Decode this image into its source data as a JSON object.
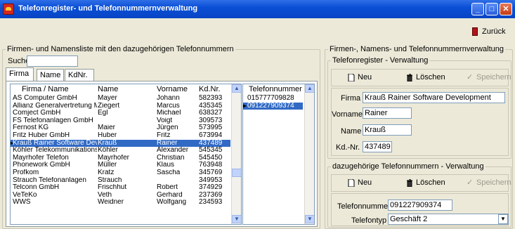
{
  "window": {
    "title": "Telefonregister- und Telefonnummernverwaltung"
  },
  "toolbar": {
    "back_label": "Zurück"
  },
  "left": {
    "legend": "Firmen- und Namensliste mit den dazugehörigen Telefonnummern",
    "search_label": "Suche",
    "search_value": "",
    "tabs": [
      "Firma",
      "Name",
      "KdNr."
    ],
    "columns": [
      "Firma / Name",
      "Name",
      "Vorname",
      "Kd.Nr."
    ],
    "rows": [
      [
        "AS Computer GmbH",
        "Mayer",
        "Johann",
        "582393"
      ],
      [
        "Allianz Generalvertretung Marcu",
        "Ziegert",
        "Marcus",
        "435345"
      ],
      [
        "Comject GmbH",
        "Egl",
        "Michael",
        "638327"
      ],
      [
        "FS Telefonanlagen GmbH",
        "",
        "Voigt",
        "309573"
      ],
      [
        "Fernost KG",
        "Maier",
        "Jürgen",
        "573995"
      ],
      [
        "Fritz Huber GmbH",
        "Huber",
        "Fritz",
        "673994"
      ],
      [
        "Krauß Rainer Software Develop",
        "Krauß",
        "Rainer",
        "437489"
      ],
      [
        "Köhler Telekommunikationsanl",
        "Köhler",
        "Alexander",
        "545345"
      ],
      [
        "Mayrhofer Telefon",
        "Mayrhofer",
        "Christian",
        "545450"
      ],
      [
        "Phonework GmbH",
        "Müller",
        "Klaus",
        "763948"
      ],
      [
        "Profkom",
        "Kratz",
        "Sascha",
        "345769"
      ],
      [
        "Strauch Telefonanlagen",
        "Strauch",
        "",
        "349953"
      ],
      [
        "Telconn GmbH",
        "Frischhut",
        "Robert",
        "374929"
      ],
      [
        "VeTeKo",
        "Veth",
        "Gerhard",
        "237369"
      ],
      [
        "WWS",
        "Weidner",
        "Wolfgang",
        "234593"
      ]
    ],
    "selected_row": 6,
    "phone_header": "Telefonnummer",
    "phones": [
      "015777709828",
      "091227909374"
    ],
    "selected_phone": 1
  },
  "right": {
    "legend": "Firmen-, Namens- und Telefonnummernverwaltung",
    "register": {
      "legend": "Telefonregister - Verwaltung",
      "new": "Neu",
      "delete": "Löschen",
      "save": "Speichern",
      "firma_label": "Firma",
      "firma": "Krauß Rainer Software Development",
      "vorname_label": "Vorname",
      "vorname": "Rainer",
      "name_label": "Name",
      "name": "Krauß",
      "kdnr_label": "Kd.-Nr.",
      "kdnr": "437489"
    },
    "numbers": {
      "legend": "dazugehörige Telefonnummern - Verwaltung",
      "new": "Neu",
      "delete": "Löschen",
      "save": "Speichern",
      "phone_label": "Telefonnummer",
      "phone": "091227909374",
      "type_label": "Telefontyp",
      "type": "Geschäft 2"
    }
  },
  "colors": {
    "title_bar": "#0a4fd6",
    "selection": "#316ac5",
    "window_bg": "#ece9d8"
  }
}
